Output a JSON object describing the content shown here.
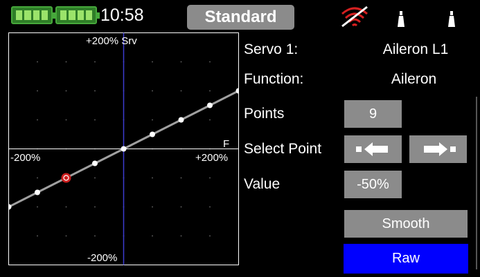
{
  "status": {
    "time": "10:58",
    "mode": "Standard",
    "colors": {
      "battery": "#2f7d28",
      "signal": "#d42020"
    },
    "icons": [
      "battery-icon",
      "battery-icon",
      "no-signal-icon",
      "antenna-icon",
      "antenna-icon"
    ]
  },
  "chart_data": {
    "type": "line",
    "x_top_label": "+200% Srv",
    "x_right_label": "+200%",
    "x_left_label": "-200%",
    "y_bottom_label": "-200%",
    "corner_label": "F",
    "xlim": [
      -200,
      200
    ],
    "ylim": [
      -200,
      200
    ],
    "grid": true,
    "series": [
      {
        "x": [
          -200,
          -150,
          -100,
          -50,
          0,
          50,
          100,
          150,
          200
        ],
        "values": [
          -100,
          -75,
          -50,
          -25,
          0,
          25,
          50,
          75,
          100
        ]
      }
    ],
    "selected_point_index": 2,
    "colors": {
      "curve": "#a0a0a0",
      "point": "#ffffff",
      "selected": "#cc1f1f",
      "y_axis": "#3c3cd2"
    }
  },
  "panel": {
    "servo_label": "Servo 1:",
    "servo_value": "Aileron L1",
    "function_label": "Function:",
    "function_value": "Aileron",
    "points_label": "Points",
    "points_value": "9",
    "select_label": "Select Point",
    "value_label": "Value",
    "value_value": "-50%",
    "smooth_label": "Smooth",
    "raw_label": "Raw",
    "colors": {
      "raw": "#0000ff",
      "button": "#8b8b8b"
    }
  }
}
